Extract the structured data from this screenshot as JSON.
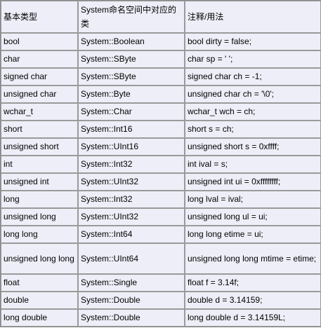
{
  "headers": [
    "基本类型",
    "System命名空间中对应的类",
    "注释/用法"
  ],
  "rows": [
    [
      "bool",
      "System::Boolean",
      "bool dirty = false;"
    ],
    [
      "char",
      "System::SByte",
      "char sp = ' ';"
    ],
    [
      "signed char",
      "System::SByte",
      "signed char ch = -1;"
    ],
    [
      "unsigned char",
      "System::Byte",
      "unsigned char ch = '\\0';"
    ],
    [
      "wchar_t",
      "System::Char",
      "wchar_t wch = ch;"
    ],
    [
      "short",
      "System::Int16",
      "short s = ch;"
    ],
    [
      "unsigned short",
      "System::UInt16",
      "unsigned short s = 0xffff;"
    ],
    [
      "int",
      "System::Int32",
      "int ival = s;"
    ],
    [
      "unsigned int",
      "System::UInt32",
      "unsigned int ui = 0xffffffff;"
    ],
    [
      "long",
      "System::Int32",
      "long lval = ival;"
    ],
    [
      "unsigned long",
      "System::UInt32",
      "unsigned long ul = ui;"
    ],
    [
      "long long",
      "System::Int64",
      "long long etime = ui;"
    ],
    [
      "unsigned long long",
      "System::UInt64",
      "unsigned long long mtime = etime;"
    ],
    [
      "float",
      "System::Single",
      "float f = 3.14f;"
    ],
    [
      "double",
      "System::Double",
      "double d = 3.14159;"
    ],
    [
      "long double",
      "System::Double",
      "long double d = 3.14159L;"
    ]
  ]
}
